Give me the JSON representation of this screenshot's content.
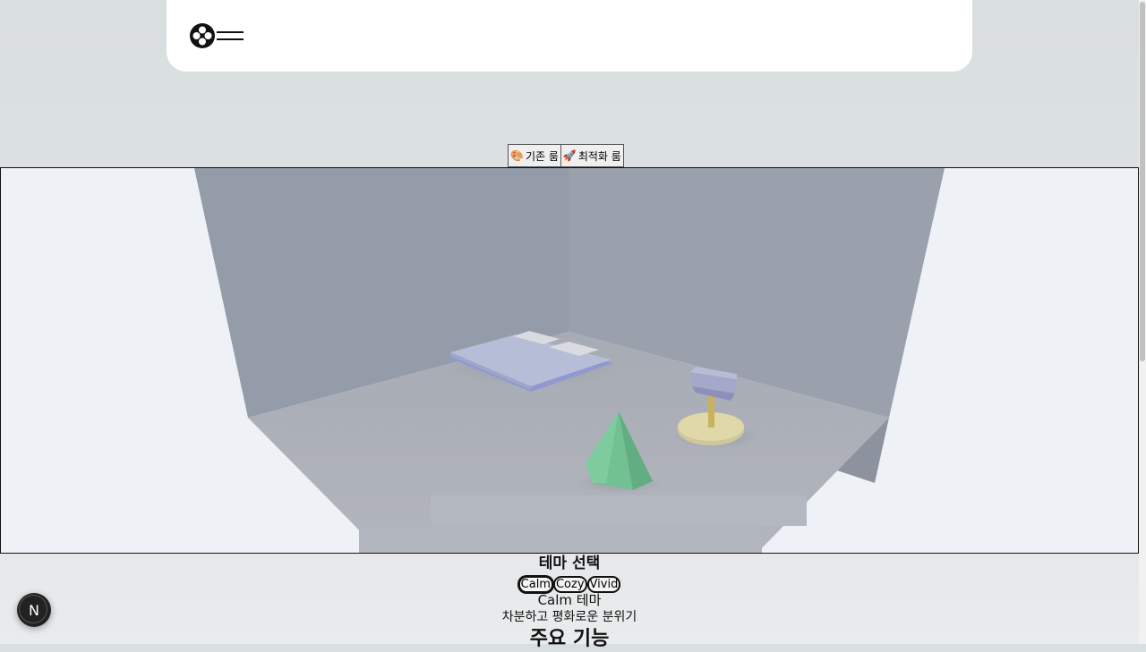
{
  "room_buttons": [
    {
      "icon": "🎨",
      "label": "기존 룸"
    },
    {
      "icon": "🚀",
      "label": "최적화 룸"
    }
  ],
  "theme_section": {
    "title": "테마 선택",
    "options": [
      "Calm",
      "Cozy",
      "Vivid"
    ],
    "selected": "Calm",
    "name": "Calm 테마",
    "description": "차분하고 평화로운 분위기"
  },
  "features_heading": "주요 기능",
  "dev_badge": "N",
  "colors": {
    "wall": "#959ca9",
    "floor": "#aeb2bb",
    "bed": "#b6bdd6",
    "cone": "#72c193",
    "lamp_base": "#e0d8a8",
    "lamp_shade": "#a4a9cb"
  }
}
